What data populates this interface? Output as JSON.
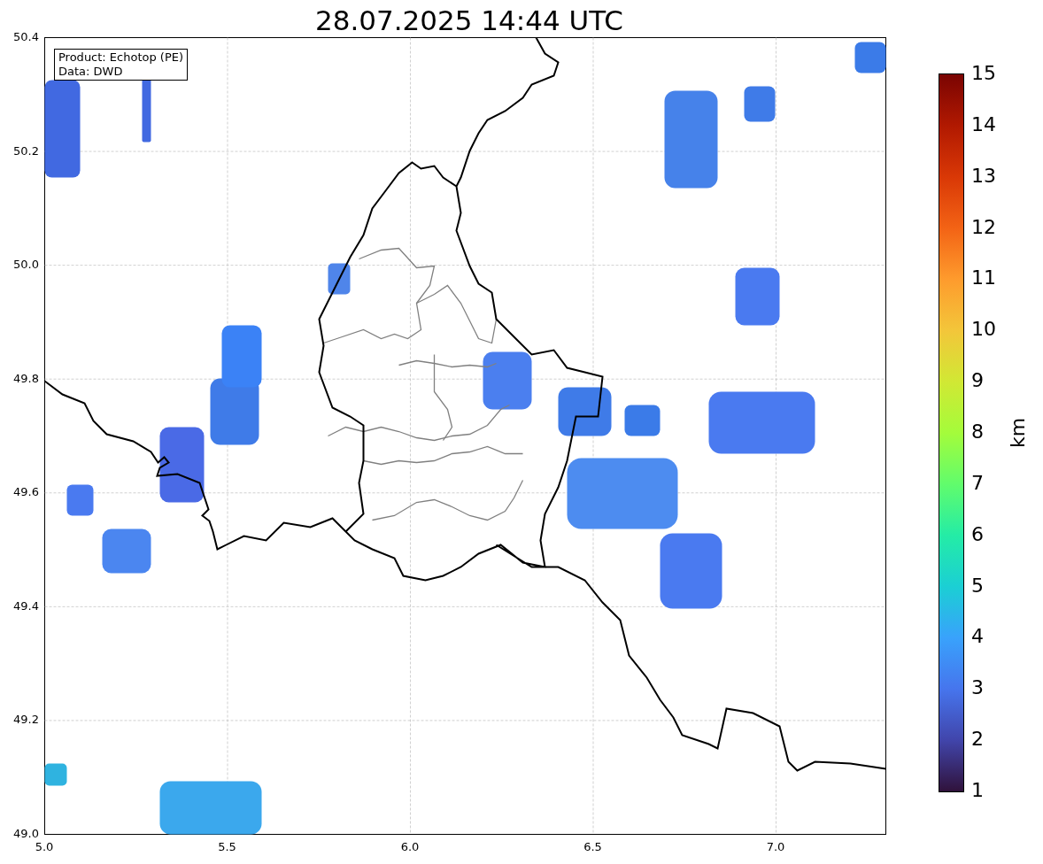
{
  "title": "28.07.2025 14:44 UTC",
  "info_box": [
    "Product: Echotop (PE)",
    "Data: DWD"
  ],
  "x_ticks": [
    "5.0",
    "5.5",
    "6.0",
    "6.5",
    "7.0"
  ],
  "y_ticks": [
    "50.4",
    "50.2",
    "50.0",
    "49.8",
    "49.6",
    "49.4",
    "49.2",
    "49.0"
  ],
  "colorbar": {
    "label": "km",
    "ticks": [
      "15",
      "14",
      "13",
      "12",
      "11",
      "10",
      "9",
      "8",
      "7",
      "6",
      "5",
      "4",
      "3",
      "2",
      "1"
    ]
  }
}
